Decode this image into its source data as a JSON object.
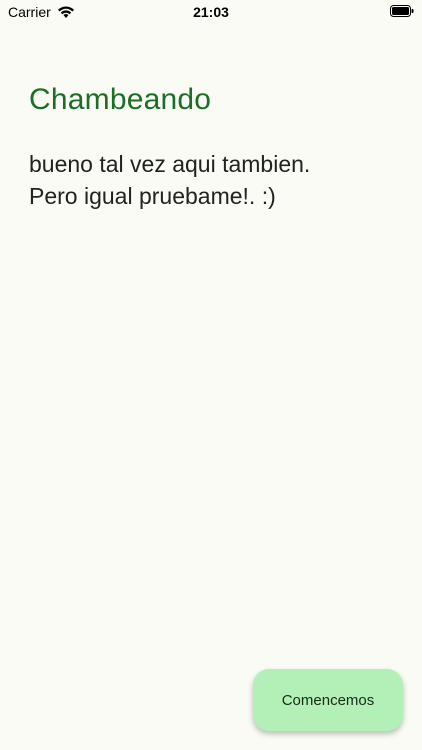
{
  "status_bar": {
    "carrier": "Carrier",
    "time": "21:03",
    "icons": [
      "wifi-icon",
      "battery-icon"
    ]
  },
  "main": {
    "title": "Chambeando",
    "body_lines": [
      "bueno tal vez aqui tambien.",
      "Pero igual pruebame!. :)"
    ]
  },
  "fab": {
    "label": "Comencemos"
  },
  "colors": {
    "background": "#fbfbf5",
    "title": "#1b6e26",
    "button_bg": "#b3f0b7"
  }
}
